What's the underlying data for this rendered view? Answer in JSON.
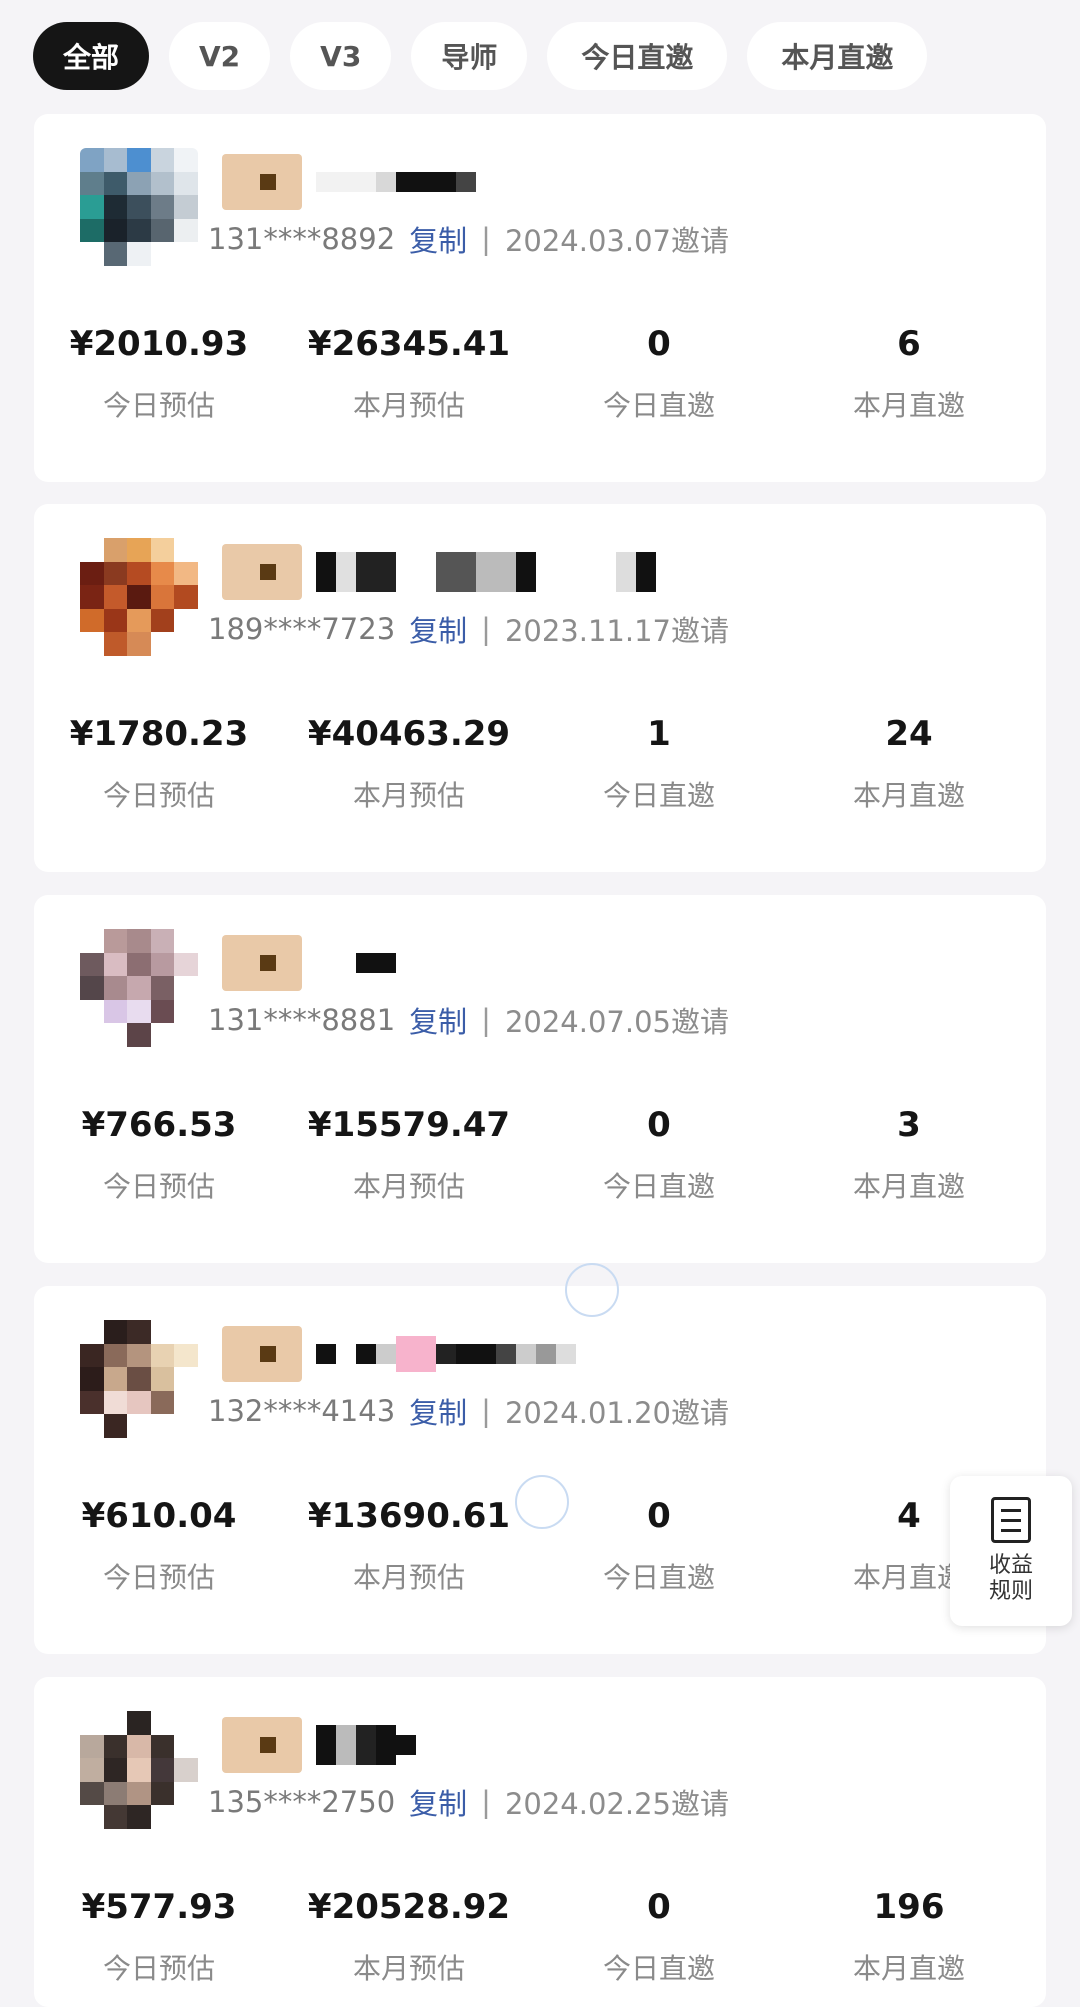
{
  "filters": {
    "tabs": [
      {
        "label": "全部",
        "active": true
      },
      {
        "label": "V2",
        "active": false
      },
      {
        "label": "V3",
        "active": false
      },
      {
        "label": "导师",
        "active": false
      },
      {
        "label": "今日直邀",
        "active": false
      },
      {
        "label": "本月直邀",
        "active": false
      }
    ]
  },
  "stat_labels": {
    "today_est": "今日预估",
    "month_est": "本月预估",
    "today_invites": "今日直邀",
    "month_invites": "本月直邀"
  },
  "members": [
    {
      "phone": "131****8892",
      "copy_label": "复制",
      "separator": "|",
      "invite_date": "2024.03.07邀请",
      "today_est": "¥2010.93",
      "month_est": "¥26345.41",
      "today_invites": "0",
      "month_invites": "6"
    },
    {
      "phone": "189****7723",
      "copy_label": "复制",
      "separator": "|",
      "invite_date": "2023.11.17邀请",
      "today_est": "¥1780.23",
      "month_est": "¥40463.29",
      "today_invites": "1",
      "month_invites": "24"
    },
    {
      "phone": "131****8881",
      "copy_label": "复制",
      "separator": "|",
      "invite_date": "2024.07.05邀请",
      "today_est": "¥766.53",
      "month_est": "¥15579.47",
      "today_invites": "0",
      "month_invites": "3"
    },
    {
      "phone": "132****4143",
      "copy_label": "复制",
      "separator": "|",
      "invite_date": "2024.01.20邀请",
      "today_est": "¥610.04",
      "month_est": "¥13690.61",
      "today_invites": "0",
      "month_invites": "4"
    },
    {
      "phone": "135****2750",
      "copy_label": "复制",
      "separator": "|",
      "invite_date": "2024.02.25邀请",
      "today_est": "¥577.93",
      "month_est": "¥20528.92",
      "today_invites": "0",
      "month_invites": "196"
    }
  ],
  "floating": {
    "rules_label": "收益规则",
    "icon": "document-list-icon"
  },
  "colors": {
    "accent_copy": "#3b5da8",
    "active_tab": "#151515",
    "background": "#f5f4f7"
  }
}
